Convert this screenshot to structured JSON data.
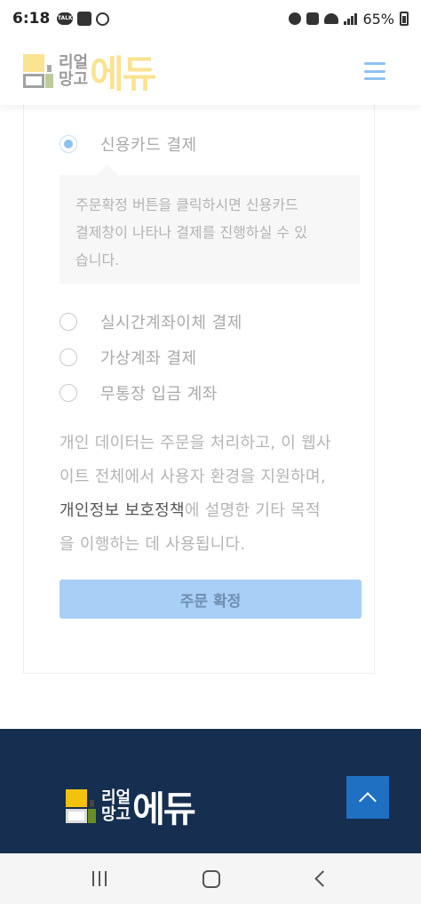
{
  "status_bar": {
    "time": "6:18",
    "talk_label": "TALK",
    "battery": "65%"
  },
  "header": {
    "logo_line1": "리얼",
    "logo_line2": "망고",
    "logo_big": "에듀",
    "menu_icon": "hamburger-icon"
  },
  "payment": {
    "options": [
      {
        "label": "신용카드 결제",
        "selected": true
      },
      {
        "label": "실시간계좌이체 결제",
        "selected": false
      },
      {
        "label": "가상계좌 결제",
        "selected": false
      },
      {
        "label": "무통장 입금 계좌",
        "selected": false
      }
    ],
    "info_text_line1": "주문확정 버튼을 클릭하시면 신용카드",
    "info_text_line2": "결제창이 나타나 결제를 진행하실 수 있",
    "info_text_line3": "습니다."
  },
  "privacy": {
    "line1": "개인 데이터는 주문을 처리하고, 이 웹사",
    "line2": "이트 전체에서 사용자 환경을 지원하며,",
    "link": "개인정보 보호정책",
    "line3_rest": "에 설명한 기타 목적",
    "line4": "을 이행하는 데 사용됩니다."
  },
  "confirm_button": "주문 확정",
  "footer": {
    "logo_line1": "리얼",
    "logo_line2": "망고",
    "logo_big": "에듀",
    "scroll_top_icon": "chevron-up-icon"
  },
  "colors": {
    "accent": "#8fc1f2",
    "button_bg": "#a8cff5",
    "footer_bg": "#162e4f",
    "top_button": "#1f6fc3",
    "logo_yellow": "#f4c20d"
  }
}
